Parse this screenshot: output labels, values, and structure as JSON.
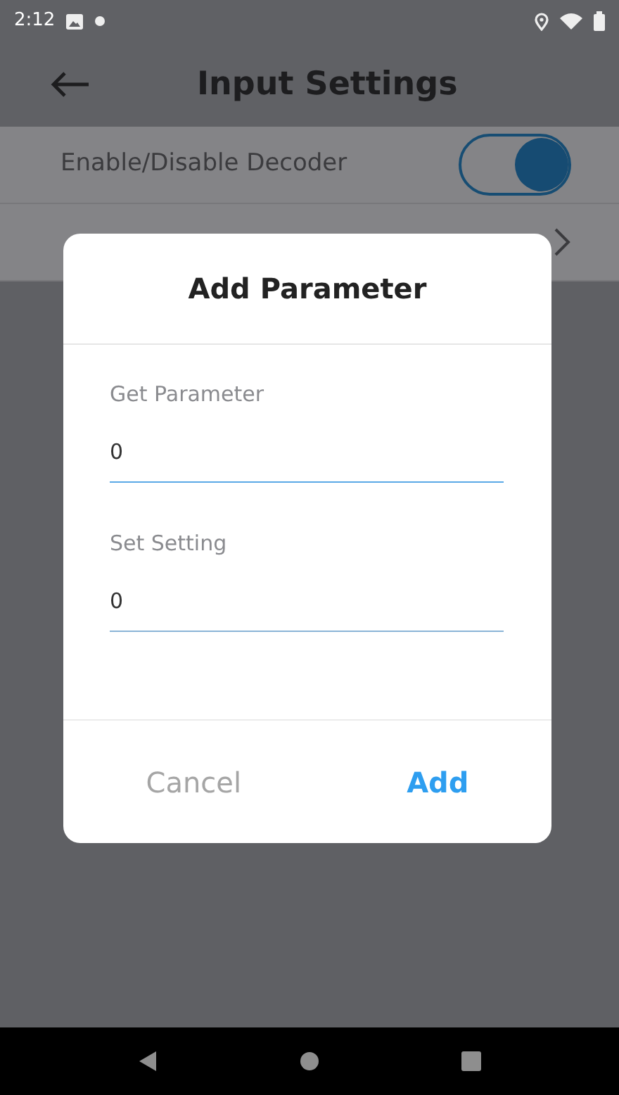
{
  "status_bar": {
    "time": "2:12"
  },
  "header": {
    "title": "Input Settings"
  },
  "settings": [
    {
      "label": "Enable/Disable Decoder",
      "kind": "toggle",
      "on": true
    },
    {
      "kind": "link"
    }
  ],
  "dialog": {
    "title": "Add Parameter",
    "fields": [
      {
        "label": "Get Parameter",
        "value": "0",
        "focused": true
      },
      {
        "label": "Set Setting",
        "value": "0",
        "focused": false
      }
    ],
    "buttons": [
      {
        "label": "Cancel",
        "kind": "cancel"
      },
      {
        "label": "Add",
        "kind": "confirm"
      }
    ]
  }
}
